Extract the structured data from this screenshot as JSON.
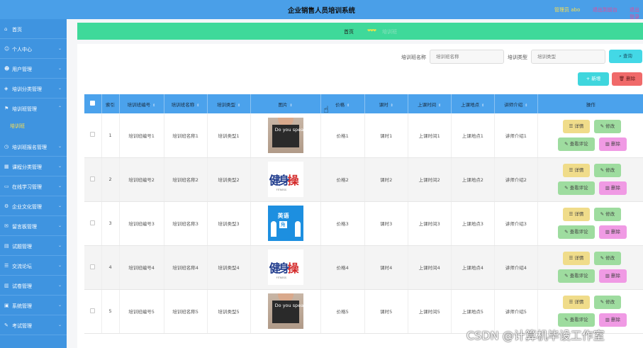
{
  "header": {
    "title": "企业销售人员培训系统",
    "admin": "管理员 abo",
    "links": [
      "退出到前台",
      "退出登录"
    ]
  },
  "sidebar": {
    "items": [
      {
        "label": "首页",
        "icon": "home-icon"
      },
      {
        "label": "个人中心",
        "icon": "user-icon"
      },
      {
        "label": "用户管理",
        "icon": "users-icon"
      },
      {
        "label": "培训分类管理",
        "icon": "tag-icon"
      },
      {
        "label": "培训班管理",
        "icon": "flag-icon"
      },
      {
        "label": "培训班报名管理",
        "icon": "clock-icon"
      },
      {
        "label": "课程分类管理",
        "icon": "grid-icon"
      },
      {
        "label": "在线学习管理",
        "icon": "monitor-icon"
      },
      {
        "label": "企业文化管理",
        "icon": "gear-icon"
      },
      {
        "label": "留言板管理",
        "icon": "chat-icon"
      },
      {
        "label": "试题管理",
        "icon": "doc-icon"
      },
      {
        "label": "交流论坛",
        "icon": "forum-icon"
      },
      {
        "label": "试卷管理",
        "icon": "paper-icon"
      },
      {
        "label": "系统管理",
        "icon": "system-icon"
      },
      {
        "label": "考试管理",
        "icon": "exam-icon"
      }
    ],
    "active_sub": "培训班"
  },
  "breadcrumb": {
    "home": "首页",
    "current": "培训班"
  },
  "search": {
    "name_label": "培训班名称",
    "name_placeholder": "培训班名称",
    "type_label": "培训类型",
    "type_placeholder": "培训类型",
    "query_button": "查询"
  },
  "toolbar": {
    "add_button": "新增",
    "delete_button": "删除"
  },
  "table": {
    "columns": [
      "索引",
      "培训班编号",
      "培训班名称",
      "培训类型",
      "图片",
      "价格",
      "课时",
      "上课时间",
      "上课地点",
      "讲师介绍",
      "操作"
    ],
    "rows": [
      {
        "index": "1",
        "code": "培训班编号1",
        "name": "培训班名称1",
        "type": "培训类型1",
        "image": "speak-english-chalkboard",
        "price": "价格1",
        "hours": "课时1",
        "time": "上课时间1",
        "place": "上课地点1",
        "intro": "讲师介绍1"
      },
      {
        "index": "2",
        "code": "培训班编号2",
        "name": "培训班名称2",
        "type": "培训类型2",
        "image": "calligraphy-logo",
        "price": "价格2",
        "hours": "课时2",
        "time": "上课时间2",
        "place": "上课地点2",
        "intro": "讲师介绍2"
      },
      {
        "index": "3",
        "code": "培训班编号3",
        "name": "培训班名称3",
        "type": "培训类型3",
        "image": "english-corner-poster",
        "price": "价格3",
        "hours": "课时3",
        "time": "上课时间3",
        "place": "上课地点3",
        "intro": "讲师介绍3"
      },
      {
        "index": "4",
        "code": "培训班编号4",
        "name": "培训班名称4",
        "type": "培训类型4",
        "image": "calligraphy-logo",
        "price": "价格4",
        "hours": "课时4",
        "time": "上课时间4",
        "place": "上课地点4",
        "intro": "讲师介绍4"
      },
      {
        "index": "5",
        "code": "培训班编号5",
        "name": "培训班名称5",
        "type": "培训类型5",
        "image": "speak-english-chalkboard",
        "price": "价格5",
        "hours": "课时5",
        "time": "上课时间5",
        "place": "上课地点5",
        "intro": "讲师介绍5"
      }
    ],
    "actions": {
      "detail": "详情",
      "edit": "修改",
      "review": "查看评论",
      "delete": "删除"
    },
    "thumb_text": {
      "chalk": "Do you speak english?",
      "calli_main": "健身",
      "calli_accent": "操",
      "calli_sub": "FITNESS",
      "english_top": "英语",
      "english_bottom": "角"
    }
  },
  "watermark": "CSDN @计算机毕设工作室",
  "colors": {
    "topbar": "#4a9fe8",
    "sidebar": "#3f94e0",
    "breadcrumb_bg": "#3fd99a",
    "table_header": "#4ba2ec",
    "detail_btn": "#f0dc8a",
    "edit_btn": "#9edc9f",
    "delete_btn": "#f09ae4"
  }
}
